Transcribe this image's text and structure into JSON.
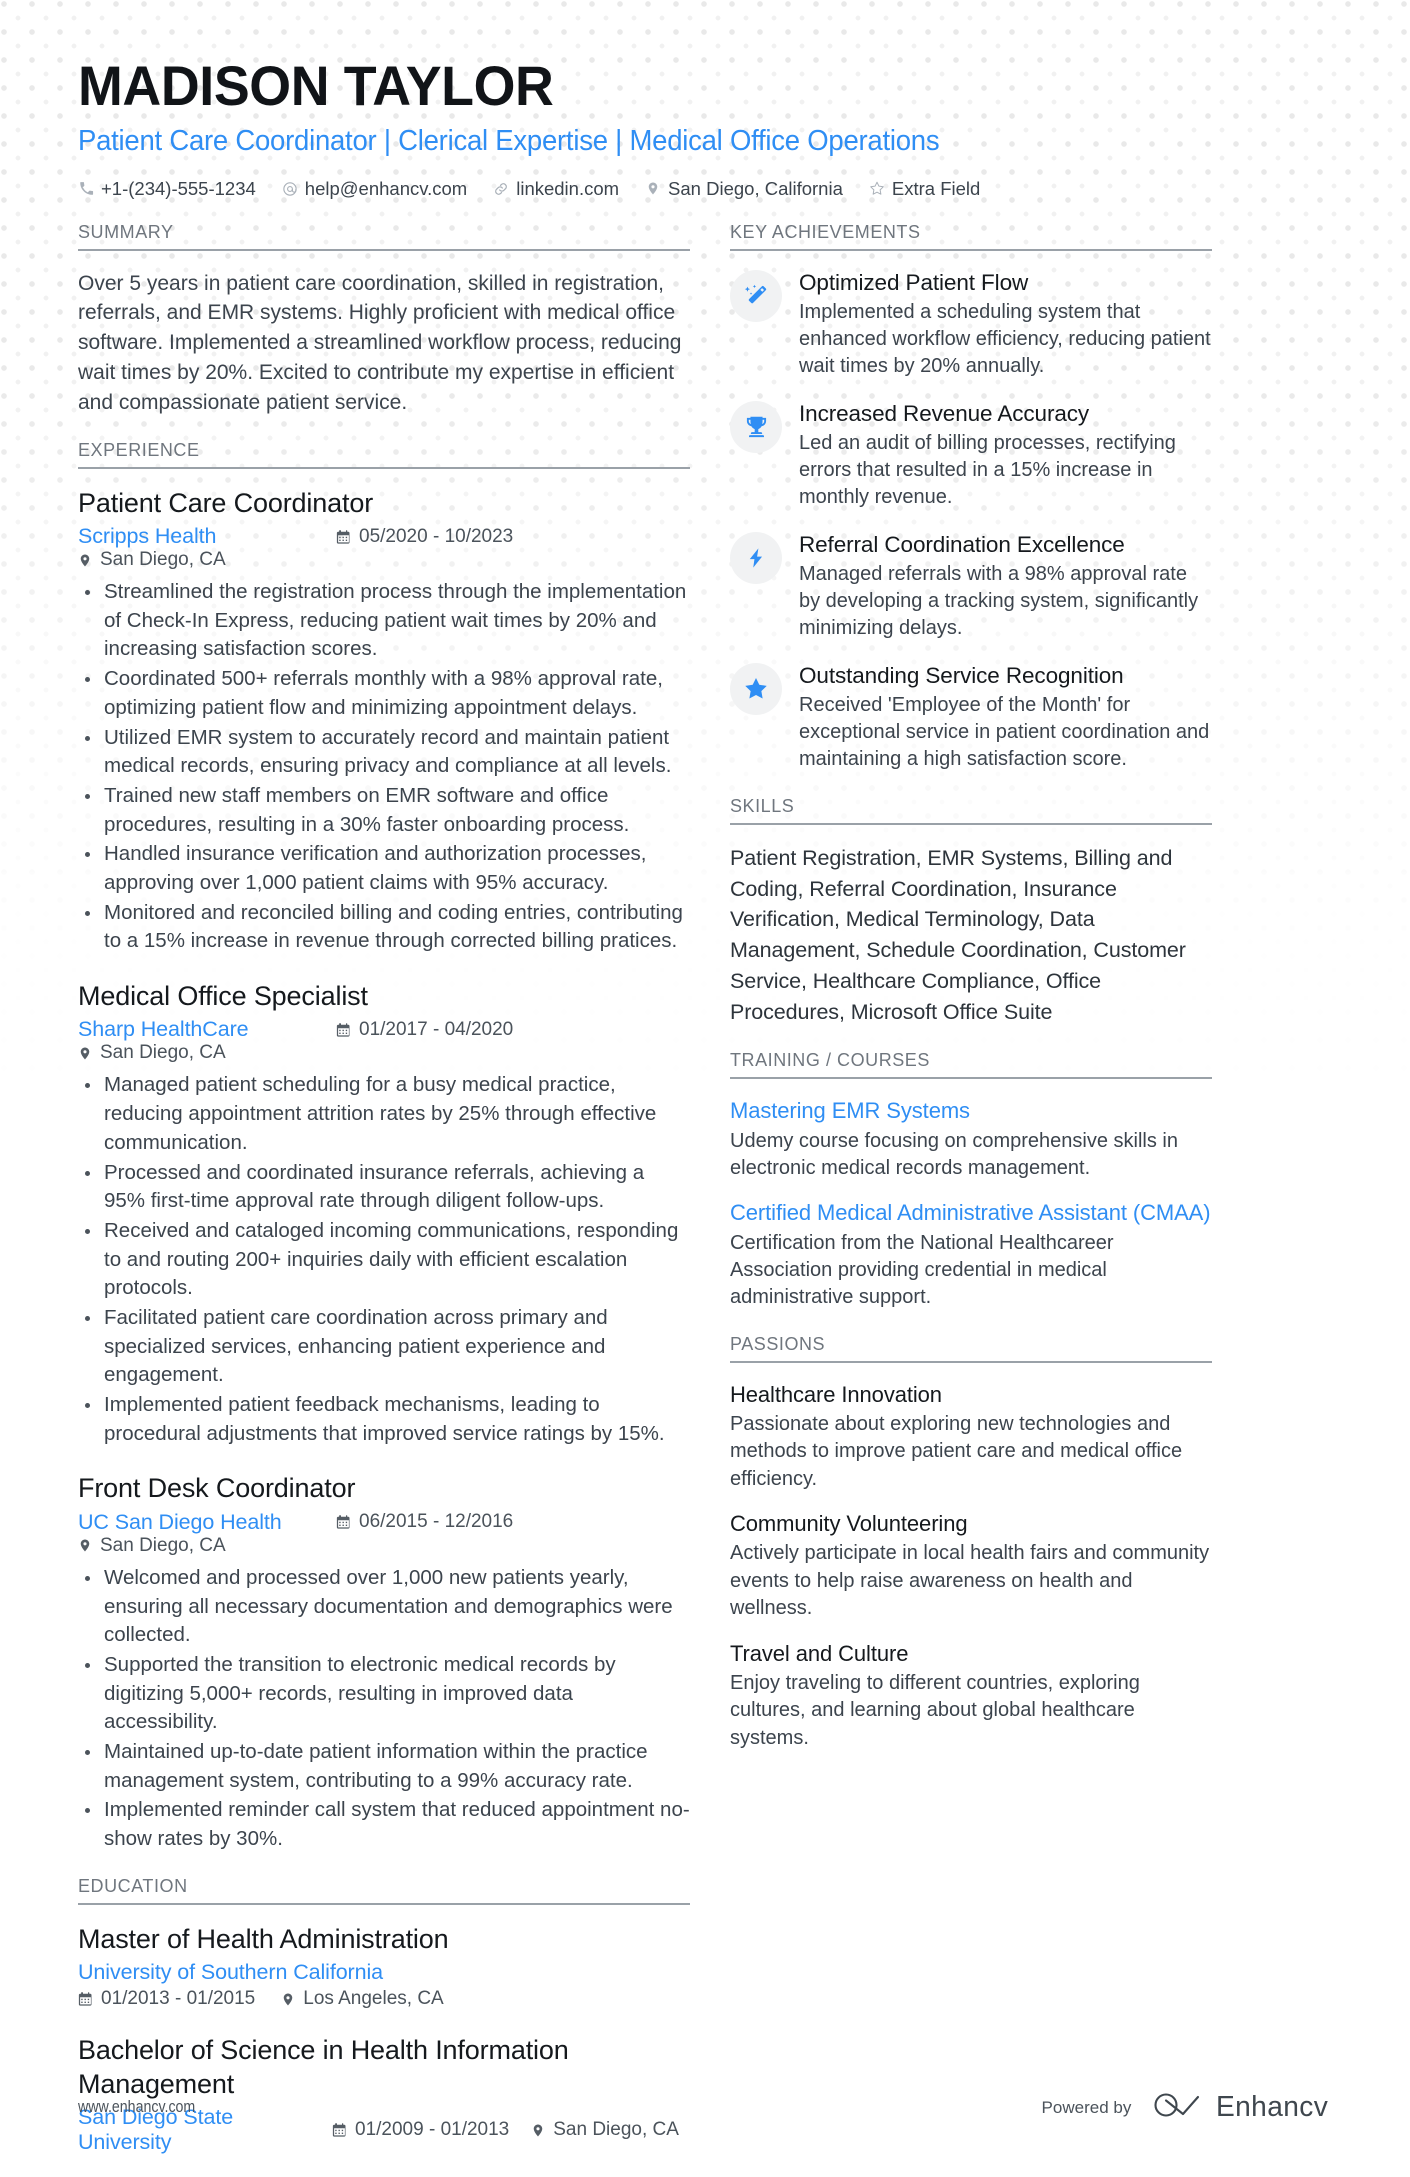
{
  "header": {
    "name": "MADISON TAYLOR",
    "headline": "Patient Care Coordinator | Clerical Expertise | Medical Office Operations",
    "contacts": [
      {
        "icon": "phone-icon",
        "text": "+1-(234)-555-1234"
      },
      {
        "icon": "email-icon",
        "text": "help@enhancv.com"
      },
      {
        "icon": "link-icon",
        "text": "linkedin.com"
      },
      {
        "icon": "location-pin-icon",
        "text": "San Diego, California"
      },
      {
        "icon": "star-outline-icon",
        "text": "Extra Field"
      }
    ]
  },
  "accent_color": "#2f8ef4",
  "sections": {
    "summary": {
      "heading": "SUMMARY",
      "text": "Over 5 years in patient care coordination, skilled in registration, referrals, and EMR systems. Highly proficient with medical office software. Implemented a streamlined workflow process, reducing wait times by 20%. Excited to contribute my expertise in efficient and compassionate patient service."
    },
    "experience": {
      "heading": "EXPERIENCE",
      "entries": [
        {
          "title": "Patient Care Coordinator",
          "org": "Scripps Health",
          "dates": "05/2020 - 10/2023",
          "location": "San Diego, CA",
          "bullets": [
            "Streamlined the registration process through the implementation of Check-In Express, reducing patient wait times by 20% and increasing satisfaction scores.",
            "Coordinated 500+ referrals monthly with a 98% approval rate, optimizing patient flow and minimizing appointment delays.",
            "Utilized EMR system to accurately record and maintain patient medical records, ensuring privacy and compliance at all levels.",
            "Trained new staff members on EMR software and office procedures, resulting in a 30% faster onboarding process.",
            "Handled insurance verification and authorization processes, approving over 1,000 patient claims with 95% accuracy.",
            "Monitored and reconciled billing and coding entries, contributing to a 15% increase in revenue through corrected billing pratices."
          ]
        },
        {
          "title": "Medical Office Specialist",
          "org": "Sharp HealthCare",
          "dates": "01/2017 - 04/2020",
          "location": "San Diego, CA",
          "bullets": [
            "Managed patient scheduling for a busy medical practice, reducing appointment attrition rates by 25% through effective communication.",
            "Processed and coordinated insurance referrals, achieving a 95% first-time approval rate through diligent follow-ups.",
            "Received and cataloged incoming communications, responding to and routing 200+ inquiries daily with efficient escalation protocols.",
            "Facilitated patient care coordination across primary and specialized services, enhancing patient experience and engagement.",
            "Implemented patient feedback mechanisms, leading to procedural adjustments that improved service ratings by 15%."
          ]
        },
        {
          "title": "Front Desk Coordinator",
          "org": "UC San Diego Health",
          "dates": "06/2015 - 12/2016",
          "location": "San Diego, CA",
          "bullets": [
            "Welcomed and processed over 1,000 new patients yearly, ensuring all necessary documentation and demographics were collected.",
            "Supported the transition to electronic medical records by digitizing 5,000+ records, resulting in improved data accessibility.",
            "Maintained up-to-date patient information within the practice management system, contributing to a 99% accuracy rate.",
            "Implemented reminder call system that reduced appointment no-show rates by 30%."
          ]
        }
      ]
    },
    "education": {
      "heading": "EDUCATION",
      "entries": [
        {
          "title": "Master of Health Administration",
          "org": "University of Southern California",
          "dates": "01/2013 - 01/2015",
          "location": "Los Angeles, CA",
          "stacked": true
        },
        {
          "title": "Bachelor of Science in Health Information Management",
          "org": "San Diego State University",
          "dates": "01/2009 - 01/2013",
          "location": "San Diego, CA",
          "stacked": false
        }
      ]
    },
    "key_achievements": {
      "heading": "KEY ACHIEVEMENTS",
      "items": [
        {
          "icon": "magic-wand-icon",
          "title": "Optimized Patient Flow",
          "desc": "Implemented a scheduling system that enhanced workflow efficiency, reducing patient wait times by 20% annually."
        },
        {
          "icon": "trophy-icon",
          "title": "Increased Revenue Accuracy",
          "desc": "Led an audit of billing processes, rectifying errors that resulted in a 15% increase in monthly revenue."
        },
        {
          "icon": "lightning-bolt-icon",
          "title": "Referral Coordination Excellence",
          "desc": "Managed referrals with a 98% approval rate by developing a tracking system, significantly minimizing delays."
        },
        {
          "icon": "star-icon",
          "title": "Outstanding Service Recognition",
          "desc": "Received 'Employee of the Month' for exceptional service in patient coordination and maintaining a high satisfaction score."
        }
      ]
    },
    "skills": {
      "heading": "SKILLS",
      "text": "Patient Registration, EMR Systems, Billing and Coding, Referral Coordination, Insurance Verification, Medical Terminology, Data Management, Schedule Coordination, Customer Service, Healthcare Compliance, Office Procedures, Microsoft Office Suite"
    },
    "training": {
      "heading": "TRAINING / COURSES",
      "items": [
        {
          "title": "Mastering EMR Systems",
          "desc": "Udemy course focusing on comprehensive skills in electronic medical records management."
        },
        {
          "title": "Certified Medical Administrative Assistant (CMAA)",
          "desc": "Certification from the National Healthcareer Association providing credential in medical administrative support."
        }
      ]
    },
    "passions": {
      "heading": "PASSIONS",
      "items": [
        {
          "title": "Healthcare Innovation",
          "desc": "Passionate about exploring new technologies and methods to improve patient care and medical office efficiency."
        },
        {
          "title": "Community Volunteering",
          "desc": "Actively participate in local health fairs and community events to help raise awareness on health and wellness."
        },
        {
          "title": "Travel and Culture",
          "desc": "Enjoy traveling to different countries, exploring cultures, and learning about global healthcare systems."
        }
      ]
    }
  },
  "footer": {
    "url": "www.enhancv.com",
    "powered_by_label": "Powered by",
    "brand_name": "Enhancv"
  }
}
